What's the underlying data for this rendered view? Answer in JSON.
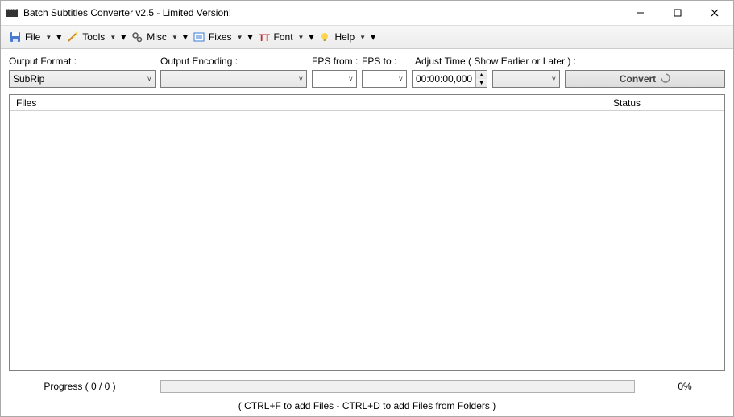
{
  "window": {
    "title": "Batch Subtitles Converter v2.5 - Limited Version!"
  },
  "menu": {
    "file": "File",
    "tools": "Tools",
    "misc": "Misc",
    "fixes": "Fixes",
    "font": "Font",
    "help": "Help"
  },
  "labels": {
    "output_format": "Output Format :",
    "output_encoding": "Output Encoding :",
    "fps_from": "FPS from :",
    "fps_to": "FPS to :",
    "adjust_time": "Adjust Time ( Show Earlier or Later ) :"
  },
  "controls": {
    "output_format_value": "SubRip",
    "output_encoding_value": "",
    "fps_from_value": "",
    "fps_to_value": "",
    "adjust_time_value": "00:00:00,000",
    "adjust_dir_value": "",
    "convert_label": "Convert"
  },
  "table": {
    "col_files": "Files",
    "col_status": "Status"
  },
  "progress": {
    "label": "Progress ( 0 / 0 )",
    "percent": "0%"
  },
  "hint": "( CTRL+F to add Files - CTRL+D to add Files from Folders )"
}
